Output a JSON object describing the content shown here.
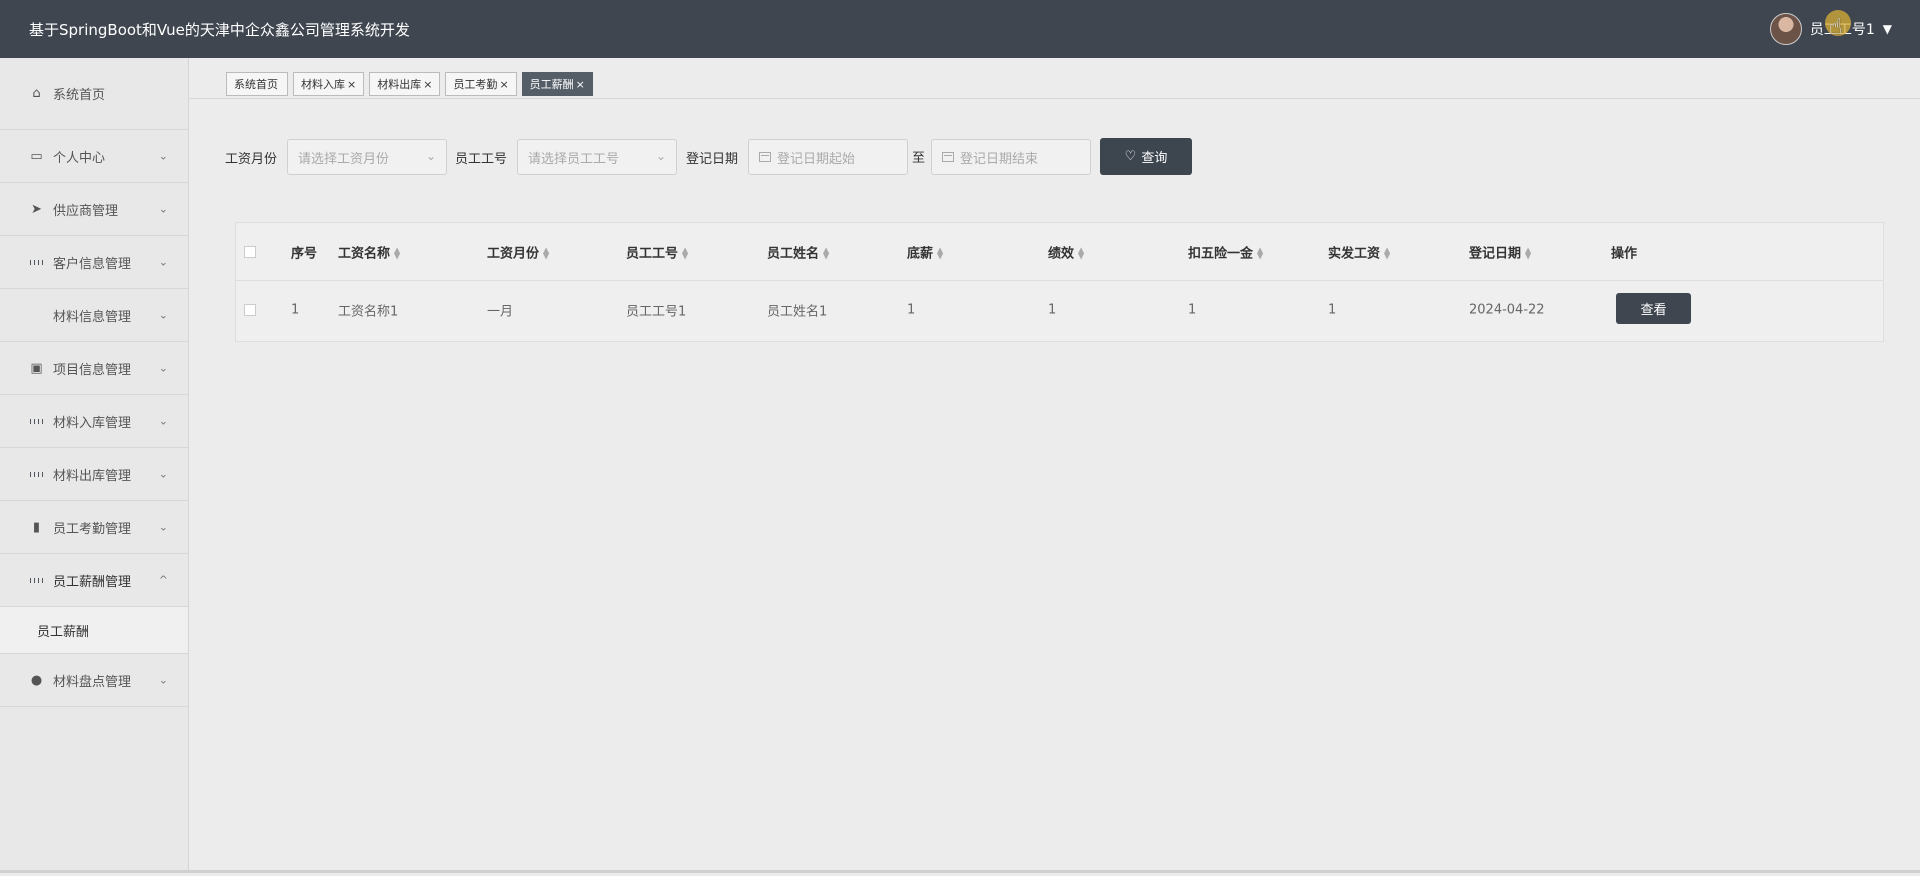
{
  "app": {
    "title": "基于SpringBoot和Vue的天津中企众鑫公司管理系统开发"
  },
  "header": {
    "user_name": "员工工号1",
    "caret": "▼",
    "avatar_icon": "user-avatar",
    "user_menu_icon": "caret-down"
  },
  "sidebar": {
    "items": [
      {
        "label": "系统首页",
        "icon": "home-icon",
        "arrow": ""
      },
      {
        "label": "个人中心",
        "icon": "card-icon",
        "arrow": "⌄"
      },
      {
        "label": "供应商管理",
        "icon": "send-icon",
        "arrow": "⌄"
      },
      {
        "label": "客户信息管理",
        "icon": "grid-icon",
        "arrow": "⌄"
      },
      {
        "label": "材料信息管理",
        "icon": "grid9-icon",
        "arrow": "⌄"
      },
      {
        "label": "项目信息管理",
        "icon": "clipboard-icon",
        "arrow": "⌄"
      },
      {
        "label": "材料入库管理",
        "icon": "grid-icon",
        "arrow": "⌄"
      },
      {
        "label": "材料出库管理",
        "icon": "grid-icon",
        "arrow": "⌄"
      },
      {
        "label": "员工考勤管理",
        "icon": "bar-chart-icon",
        "arrow": "⌄"
      },
      {
        "label": "员工薪酬管理",
        "icon": "grid-icon",
        "arrow": "^"
      },
      {
        "label": "员工薪酬",
        "submenu": true
      },
      {
        "label": "材料盘点管理",
        "icon": "balloon-icon",
        "arrow": "⌄"
      }
    ]
  },
  "tabs": [
    {
      "label": "系统首页",
      "close": ""
    },
    {
      "label": "材料入库",
      "close": "×"
    },
    {
      "label": "材料出库",
      "close": "×"
    },
    {
      "label": "员工考勤",
      "close": "×"
    },
    {
      "label": "员工薪酬",
      "close": "×",
      "active": true
    }
  ],
  "filters": {
    "salary_month_label": "工资月份",
    "salary_month_placeholder": "请选择工资月份",
    "employee_id_label": "员工工号",
    "employee_id_placeholder": "请选择员工工号",
    "date_label": "登记日期",
    "start_placeholder": "登记日期起始",
    "to_label": "至",
    "end_placeholder": "登记日期结束",
    "search_label": "查询",
    "search_icon": "heart-icon"
  },
  "table": {
    "headers": [
      "序号",
      "工资名称",
      "工资月份",
      "员工工号",
      "员工姓名",
      "底薪",
      "绩效",
      "扣五险一金",
      "实发工资",
      "登记日期",
      "操作"
    ],
    "rows": [
      {
        "index": "1",
        "salary_name": "工资名称1",
        "month": "一月",
        "employee_id": "员工工号1",
        "employee_name": "员工姓名1",
        "base": "1",
        "performance": "1",
        "deduction": "1",
        "actual": "1",
        "date": "2024-04-22",
        "action": "查看"
      }
    ]
  }
}
